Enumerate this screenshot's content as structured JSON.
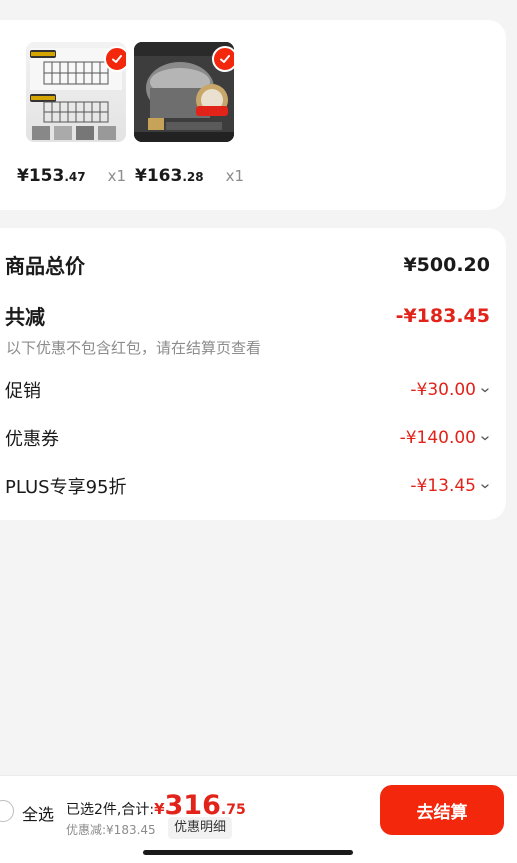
{
  "products": [
    {
      "name": "drying-rack",
      "yen": "¥",
      "price_int": "153",
      "price_dec": ".47",
      "qty": "x1"
    },
    {
      "name": "rice-cooker",
      "yen": "¥",
      "price_int": "163",
      "price_dec": ".28",
      "qty": "x1"
    }
  ],
  "summary": {
    "total_label": "商品总价",
    "total_value": "¥500.20",
    "reduce_label": "共减",
    "reduce_value": "-¥183.45",
    "note": "以下优惠不包含红包，请在结算页查看",
    "items": [
      {
        "label": "促销",
        "value": "-¥30.00"
      },
      {
        "label": "优惠券",
        "value": "-¥140.00"
      },
      {
        "label": "PLUS专享95折",
        "value": "-¥13.45"
      }
    ]
  },
  "bottom": {
    "select_all": "全选",
    "selected_text": "已选2件,合计:",
    "yen": "¥",
    "total_int": "316",
    "total_dec": ".75",
    "discount": "优惠减:¥183.45",
    "detail_button": "优惠明细",
    "checkout": "去结算"
  },
  "colors": {
    "accent": "#f2270c",
    "price_red": "#e2231a"
  },
  "icons": {
    "check": "check-icon",
    "chevron": "chevron-down-icon"
  }
}
